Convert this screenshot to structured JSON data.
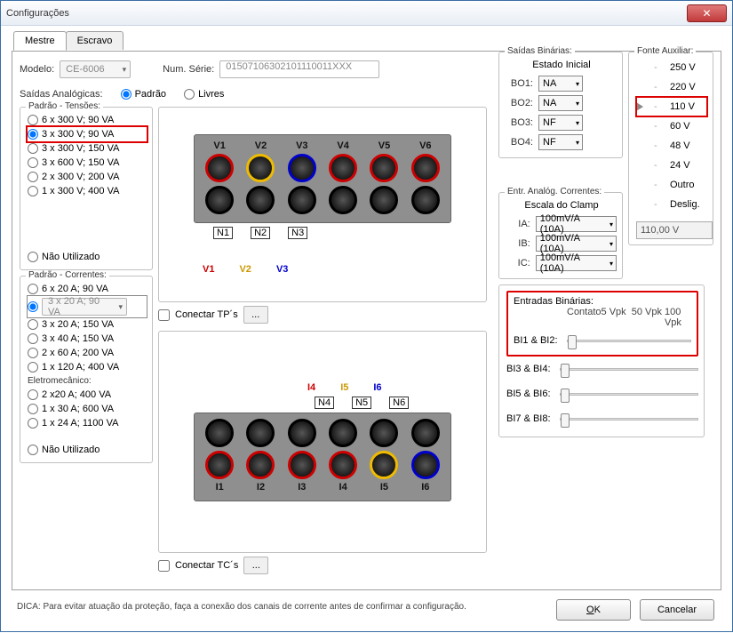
{
  "window": {
    "title": "Configurações"
  },
  "tabs": {
    "master": "Mestre",
    "slave": "Escravo"
  },
  "model": {
    "label": "Modelo:",
    "value": "CE-6006",
    "serial_label": "Num. Série:",
    "serial_value": "01507106302101110011XXX"
  },
  "saidas_analogicas": {
    "label": "Saídas Analógicas:",
    "padrao": "Padrão",
    "livres": "Livres"
  },
  "tensoes": {
    "legend": "Padrão - Tensões:",
    "items": [
      "6 x 300 V; 90 VA",
      "3 x 300 V; 90 VA",
      "3 x 300 V; 150 VA",
      "3 x 600 V; 150 VA",
      "2 x 300 V; 200 VA",
      "1 x 300 V; 400 VA"
    ],
    "nao_utilizado": "Não Utilizado"
  },
  "correntes": {
    "legend": "Padrão - Correntes:",
    "items": [
      "6 x 20 A; 90 VA",
      "3 x 20 A; 90 VA",
      "3 x 20 A; 150 VA",
      "3 x 40 A; 150 VA",
      "2 x 60 A; 200 VA",
      "1 x 120 A; 400 VA"
    ],
    "eletromec_legend": "Eletromecânico:",
    "eletromec": [
      "2 x20 A; 400 VA",
      "1 x 30 A; 600 VA",
      "1 x 24 A; 1100 VA"
    ],
    "nao_utilizado": "Não Utilizado"
  },
  "conectar_tp": "Conectar TP´s",
  "conectar_tc": "Conectar TC´s",
  "voltage_diagram": {
    "top_labels": [
      "V1",
      "V2",
      "V3",
      "V4",
      "V5",
      "V6"
    ],
    "n_labels": [
      "N1",
      "N2",
      "N3"
    ],
    "bottom_labels": [
      "V1",
      "V2",
      "V3"
    ]
  },
  "current_diagram": {
    "i_top": [
      "I4",
      "I5",
      "I6"
    ],
    "n_labels": [
      "N4",
      "N5",
      "N6"
    ],
    "bottom_labels": [
      "I1",
      "I2",
      "I3",
      "I4",
      "I5",
      "I6"
    ]
  },
  "saidas_bin": {
    "legend": "Saídas Binárias:",
    "estado_inicial": "Estado Inicial",
    "rows": [
      {
        "label": "BO1:",
        "value": "NA"
      },
      {
        "label": "BO2:",
        "value": "NA"
      },
      {
        "label": "BO3:",
        "value": "NF"
      },
      {
        "label": "BO4:",
        "value": "NF"
      }
    ]
  },
  "entr_analog": {
    "legend": "Entr. Analóg. Correntes:",
    "escala": "Escala do Clamp",
    "rows": [
      {
        "label": "IA:",
        "value": "100mV/A (10A)"
      },
      {
        "label": "IB:",
        "value": "100mV/A (10A)"
      },
      {
        "label": "IC:",
        "value": "100mV/A (10A)"
      }
    ]
  },
  "entradas_bin": {
    "legend": "Entradas Binárias:",
    "scale": [
      "Contato",
      "5 Vpk",
      "50 Vpk",
      "100 Vpk"
    ],
    "rows": [
      "BI1 & BI2:",
      "BI3 & BI4:",
      "BI5 & BI6:",
      "BI7 & BI8:"
    ]
  },
  "fonte_aux": {
    "legend": "Fonte Auxiliar:",
    "items": [
      "250 V",
      "220 V",
      "110 V",
      "60 V",
      "48 V",
      "24 V",
      "Outro",
      "Deslig."
    ],
    "value": "110,00 V"
  },
  "hint": "DICA: Para evitar atuação da proteção, faça a conexão dos canais de corrente antes de confirmar a configuração.",
  "buttons": {
    "ok": "OK",
    "cancel": "Cancelar"
  }
}
